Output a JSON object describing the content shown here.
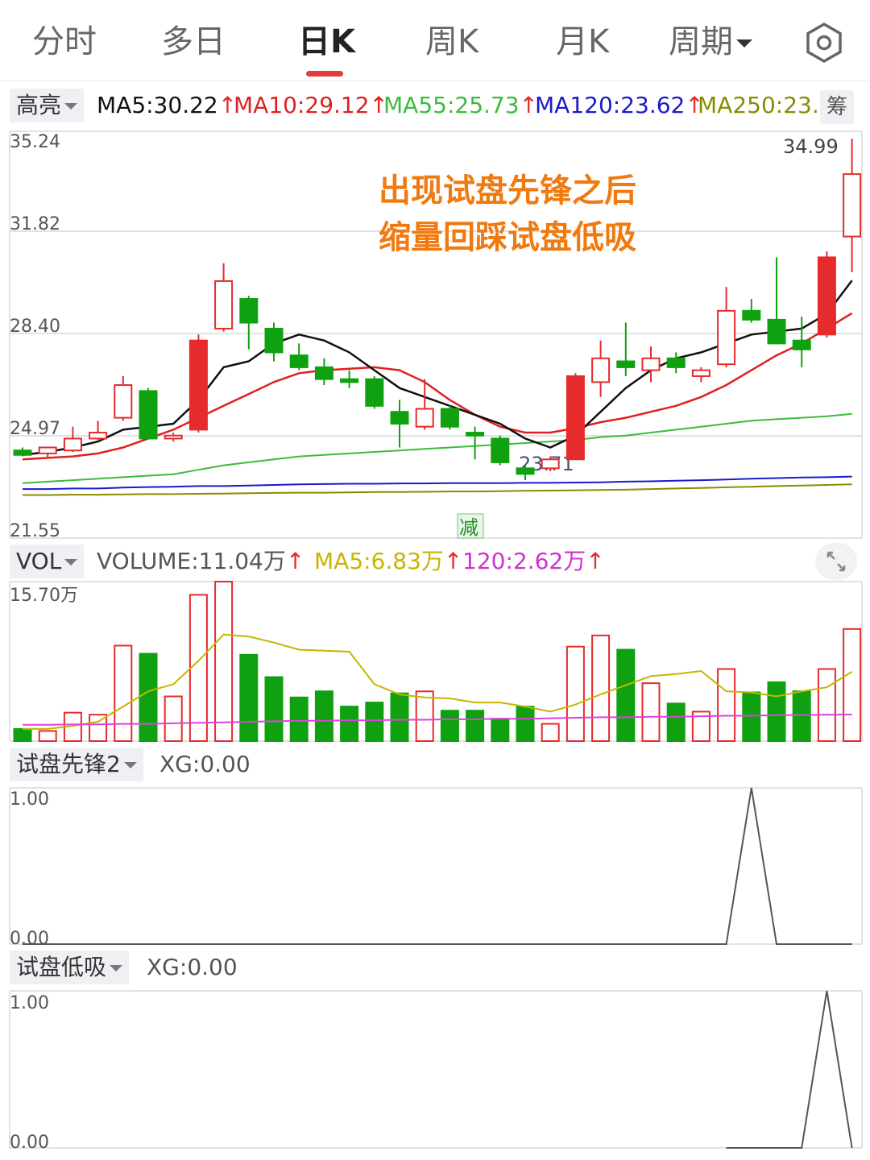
{
  "tabs": [
    {
      "label": "分时"
    },
    {
      "label": "多日"
    },
    {
      "label": "日K"
    },
    {
      "label": "周K"
    },
    {
      "label": "月K"
    },
    {
      "label": "周期"
    }
  ],
  "active_tab": "日K",
  "main_panel": {
    "indicator_selector": "高亮",
    "ma": [
      {
        "label": "MA5:30.22",
        "color": "#111111"
      },
      {
        "label": "MA10:29.12",
        "color": "#e02020"
      },
      {
        "label": "MA55:25.73",
        "color": "#3cbb3c"
      },
      {
        "label": "MA120:23.62",
        "color": "#1a1acc"
      },
      {
        "label": "MA250:23.",
        "color": "#8b8b00"
      }
    ],
    "chip_button": "筹",
    "axis_labels": [
      "35.24",
      "31.82",
      "28.40",
      "24.97",
      "21.55"
    ],
    "high_label": "34.99",
    "low_label": "23.71",
    "badge": "减",
    "annotation_line1": "出现试盘先锋之后",
    "annotation_line2": "缩量回踩试盘低吸",
    "annotation_color": "#f07a10"
  },
  "volume_panel": {
    "selector": "VOL",
    "volume_label": "VOLUME:11.04万",
    "ma5_label": "MA5:6.83万",
    "ma120_label": "120:2.62万",
    "axis_top": "15.70万"
  },
  "xg1_panel": {
    "selector": "试盘先锋2",
    "value_label": "XG:0.00",
    "axis_top": "1.00",
    "axis_bottom": "0.00"
  },
  "xg2_panel": {
    "selector": "试盘低吸",
    "value_label": "XG:0.00",
    "axis_top": "1.00",
    "axis_bottom": "0.00"
  },
  "chart_data": {
    "type": "candlestick",
    "price_range": [
      21.55,
      35.24
    ],
    "candles": [
      {
        "o": 24.5,
        "h": 24.6,
        "l": 24.3,
        "c": 24.35
      },
      {
        "o": 24.4,
        "h": 24.6,
        "l": 24.25,
        "c": 24.6
      },
      {
        "o": 24.5,
        "h": 25.3,
        "l": 24.45,
        "c": 24.9
      },
      {
        "o": 24.9,
        "h": 25.5,
        "l": 24.85,
        "c": 25.1
      },
      {
        "o": 25.6,
        "h": 27.0,
        "l": 25.5,
        "c": 26.7
      },
      {
        "o": 26.5,
        "h": 26.6,
        "l": 25.0,
        "c": 24.9
      },
      {
        "o": 24.9,
        "h": 25.1,
        "l": 24.8,
        "c": 25.0
      },
      {
        "o": 25.2,
        "h": 28.4,
        "l": 25.1,
        "c": 28.2
      },
      {
        "o": 28.6,
        "h": 30.8,
        "l": 28.5,
        "c": 30.2
      },
      {
        "o": 29.6,
        "h": 29.7,
        "l": 27.9,
        "c": 28.8
      },
      {
        "o": 28.6,
        "h": 28.8,
        "l": 27.5,
        "c": 27.8
      },
      {
        "o": 27.7,
        "h": 28.1,
        "l": 27.2,
        "c": 27.3
      },
      {
        "o": 27.3,
        "h": 27.6,
        "l": 26.7,
        "c": 26.9
      },
      {
        "o": 26.9,
        "h": 27.2,
        "l": 26.6,
        "c": 26.8
      },
      {
        "o": 26.9,
        "h": 27.0,
        "l": 25.9,
        "c": 26.0
      },
      {
        "o": 25.8,
        "h": 26.2,
        "l": 24.6,
        "c": 25.4
      },
      {
        "o": 25.3,
        "h": 26.9,
        "l": 25.2,
        "c": 25.9
      },
      {
        "o": 25.9,
        "h": 26.0,
        "l": 25.2,
        "c": 25.3
      },
      {
        "o": 25.1,
        "h": 25.3,
        "l": 24.2,
        "c": 25.0
      },
      {
        "o": 24.9,
        "h": 25.0,
        "l": 24.0,
        "c": 24.1
      },
      {
        "o": 23.9,
        "h": 24.0,
        "l": 23.5,
        "c": 23.71
      },
      {
        "o": 23.9,
        "h": 24.3,
        "l": 23.8,
        "c": 24.2
      },
      {
        "o": 24.2,
        "h": 27.1,
        "l": 24.2,
        "c": 27.0
      },
      {
        "o": 26.8,
        "h": 28.2,
        "l": 26.3,
        "c": 27.6
      },
      {
        "o": 27.5,
        "h": 28.8,
        "l": 27.0,
        "c": 27.3
      },
      {
        "o": 27.2,
        "h": 28.0,
        "l": 26.8,
        "c": 27.6
      },
      {
        "o": 27.6,
        "h": 27.8,
        "l": 27.1,
        "c": 27.3
      },
      {
        "o": 27.0,
        "h": 27.3,
        "l": 26.8,
        "c": 27.2
      },
      {
        "o": 27.4,
        "h": 30.0,
        "l": 27.3,
        "c": 29.2
      },
      {
        "o": 29.2,
        "h": 29.6,
        "l": 28.8,
        "c": 28.9
      },
      {
        "o": 28.9,
        "h": 31.0,
        "l": 28.3,
        "c": 28.1
      },
      {
        "o": 28.2,
        "h": 29.0,
        "l": 27.3,
        "c": 27.9
      },
      {
        "o": 28.4,
        "h": 31.2,
        "l": 28.3,
        "c": 31.0
      },
      {
        "o": 31.7,
        "h": 34.99,
        "l": 30.5,
        "c": 33.8
      }
    ],
    "ma5": [
      24.35,
      24.45,
      24.6,
      24.8,
      25.2,
      25.3,
      25.4,
      26.2,
      27.3,
      27.5,
      28.1,
      28.4,
      28.2,
      27.8,
      27.2,
      26.6,
      26.3,
      26.0,
      25.7,
      25.4,
      24.9,
      24.6,
      25.0,
      25.8,
      26.6,
      27.2,
      27.6,
      27.8,
      28.1,
      28.4,
      28.5,
      28.6,
      29.1,
      30.22
    ],
    "ma10": [
      24.2,
      24.25,
      24.3,
      24.4,
      24.6,
      24.9,
      25.2,
      25.6,
      26.0,
      26.4,
      26.8,
      27.1,
      27.2,
      27.25,
      27.3,
      27.2,
      26.8,
      26.2,
      25.7,
      25.3,
      25.1,
      25.1,
      25.25,
      25.45,
      25.6,
      25.8,
      26.0,
      26.3,
      26.7,
      27.2,
      27.7,
      28.1,
      28.6,
      29.12
    ],
    "ma55": [
      23.4,
      23.45,
      23.5,
      23.55,
      23.6,
      23.65,
      23.7,
      23.85,
      24.0,
      24.1,
      24.2,
      24.3,
      24.35,
      24.4,
      24.45,
      24.5,
      24.55,
      24.6,
      24.65,
      24.7,
      24.75,
      24.8,
      24.85,
      24.95,
      25.0,
      25.1,
      25.2,
      25.3,
      25.4,
      25.5,
      25.55,
      25.6,
      25.65,
      25.73
    ],
    "ma120": [
      23.2,
      23.2,
      23.22,
      23.22,
      23.25,
      23.27,
      23.28,
      23.3,
      23.3,
      23.32,
      23.34,
      23.36,
      23.37,
      23.38,
      23.38,
      23.39,
      23.39,
      23.4,
      23.4,
      23.4,
      23.41,
      23.41,
      23.42,
      23.43,
      23.45,
      23.46,
      23.48,
      23.5,
      23.52,
      23.55,
      23.57,
      23.59,
      23.6,
      23.62
    ],
    "ma250": [
      23.0,
      23.0,
      23.01,
      23.01,
      23.02,
      23.03,
      23.03,
      23.04,
      23.05,
      23.06,
      23.07,
      23.08,
      23.08,
      23.09,
      23.1,
      23.1,
      23.11,
      23.12,
      23.12,
      23.13,
      23.14,
      23.15,
      23.16,
      23.17,
      23.18,
      23.2,
      23.22,
      23.24,
      23.26,
      23.28,
      23.3,
      23.32,
      23.34,
      23.36
    ],
    "volume_max": 15.7,
    "volume": [
      1.2,
      1.0,
      2.8,
      2.6,
      9.4,
      8.6,
      4.4,
      14.4,
      15.7,
      8.5,
      6.3,
      4.3,
      4.9,
      3.4,
      3.8,
      4.7,
      4.9,
      3.0,
      3.0,
      2.2,
      3.4,
      1.7,
      9.3,
      10.4,
      9.0,
      5.7,
      3.7,
      2.9,
      7.1,
      4.8,
      5.8,
      4.9,
      7.1,
      11.04
    ],
    "volume_ma5": [
      1.2,
      1.2,
      1.5,
      1.9,
      3.4,
      4.9,
      5.6,
      7.9,
      10.5,
      10.3,
      9.7,
      9.0,
      8.9,
      8.8,
      5.6,
      4.6,
      4.3,
      4.2,
      3.8,
      3.8,
      3.4,
      2.9,
      3.6,
      4.6,
      5.5,
      6.4,
      6.6,
      6.9,
      4.9,
      4.8,
      4.4,
      4.9,
      5.3,
      6.83
    ],
    "volume_ma120": [
      1.6,
      1.6,
      1.65,
      1.65,
      1.7,
      1.7,
      1.75,
      1.8,
      1.85,
      1.9,
      1.95,
      2.0,
      2.0,
      2.05,
      2.05,
      2.1,
      2.1,
      2.15,
      2.15,
      2.2,
      2.2,
      2.25,
      2.3,
      2.35,
      2.35,
      2.4,
      2.4,
      2.45,
      2.5,
      2.5,
      2.55,
      2.55,
      2.6,
      2.62
    ],
    "xg1": [
      0,
      0,
      0,
      0,
      0,
      0,
      0,
      0,
      0,
      0,
      0,
      0,
      0,
      0,
      0,
      0,
      0,
      0,
      0,
      0,
      0,
      0,
      0,
      0,
      0,
      0,
      0,
      0,
      0,
      1,
      0,
      0,
      0,
      0
    ],
    "xg2": [
      0,
      0,
      0,
      0,
      0,
      0,
      0,
      0,
      0,
      0,
      0,
      0,
      0,
      0,
      0,
      0,
      0,
      0,
      0,
      0,
      0,
      0,
      0,
      0,
      0,
      0,
      0,
      0,
      0,
      0,
      0,
      0,
      1,
      0
    ],
    "colors": {
      "up": "#e52b2b",
      "down": "#0fa10f",
      "grid": "#d9d9d9",
      "axis_text": "#555555",
      "volume_ma5": "#c8b400",
      "volume_ma120": "#e040e0",
      "xg_line": "#555555"
    }
  }
}
